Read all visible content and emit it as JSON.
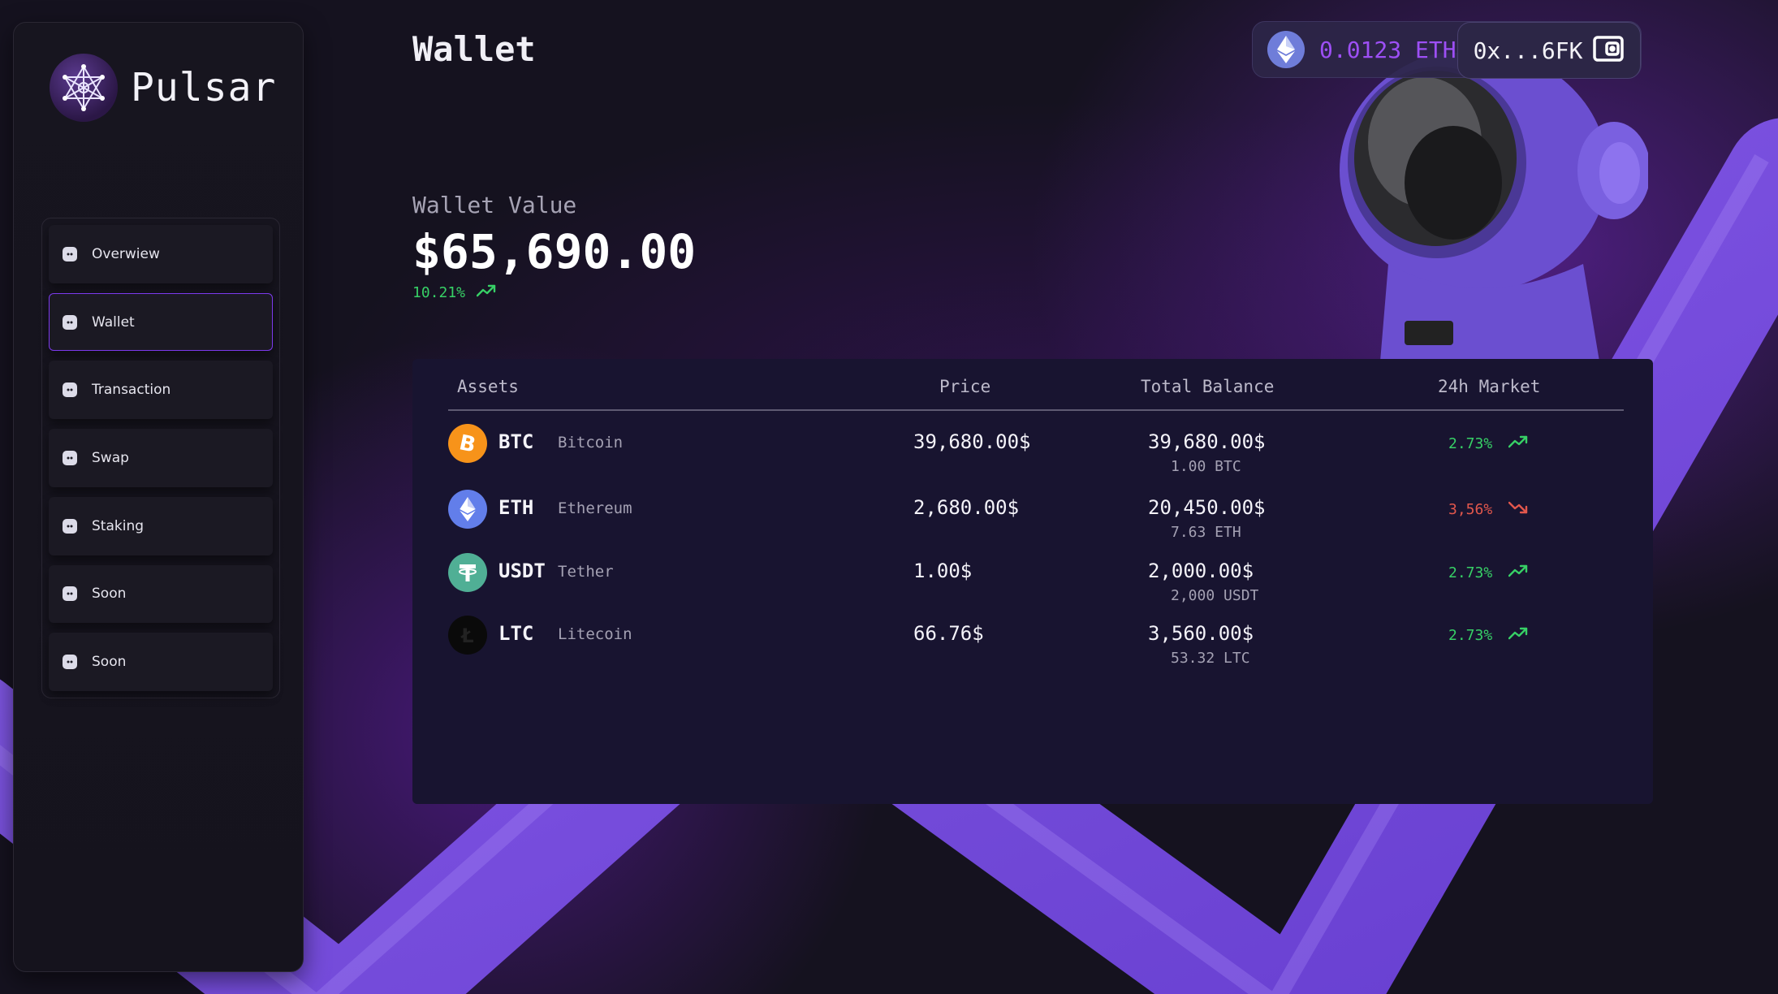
{
  "app": {
    "name": "Pulsar"
  },
  "sidebar": {
    "items": [
      {
        "label": "Overwiew",
        "active": false
      },
      {
        "label": "Wallet",
        "active": true
      },
      {
        "label": "Transaction",
        "active": false
      },
      {
        "label": "Swap",
        "active": false
      },
      {
        "label": "Staking",
        "active": false
      },
      {
        "label": "Soon",
        "active": false
      },
      {
        "label": "Soon",
        "active": false
      }
    ]
  },
  "header": {
    "title": "Wallet",
    "eth_balance": "0.0123 ETH",
    "address": "0x...6FK"
  },
  "summary": {
    "label": "Wallet Value",
    "value": "$65,690.00",
    "change": "10.21%",
    "change_direction": "up"
  },
  "table": {
    "columns": [
      "Assets",
      "Price",
      "Total Balance",
      "24h Market"
    ],
    "rows": [
      {
        "ticker": "BTC",
        "name": "Bitcoin",
        "price": "39,680.00$",
        "balance": "39,680.00$",
        "amount": "1.00 BTC",
        "change": "2.73%",
        "direction": "up",
        "icon": "bitcoin-icon",
        "color": "#f7931a"
      },
      {
        "ticker": "ETH",
        "name": "Ethereum",
        "price": "2,680.00$",
        "balance": "20,450.00$",
        "amount": "7.63 ETH",
        "change": "3,56%",
        "direction": "down",
        "icon": "ethereum-icon",
        "color": "#627eea"
      },
      {
        "ticker": "USDT",
        "name": "Tether",
        "price": "1.00$",
        "balance": "2,000.00$",
        "amount": "2,000 USDT",
        "change": "2.73%",
        "direction": "up",
        "icon": "tether-icon",
        "color": "#50af95"
      },
      {
        "ticker": "LTC",
        "name": "Litecoin",
        "price": "66.76$",
        "balance": "3,560.00$",
        "amount": "53.32 LTC",
        "change": "2.73%",
        "direction": "up",
        "icon": "litecoin-icon",
        "color": "#0a0a0a"
      }
    ]
  },
  "colors": {
    "accent": "#7c3aed",
    "positive": "#37d066",
    "negative": "#e2574c"
  }
}
